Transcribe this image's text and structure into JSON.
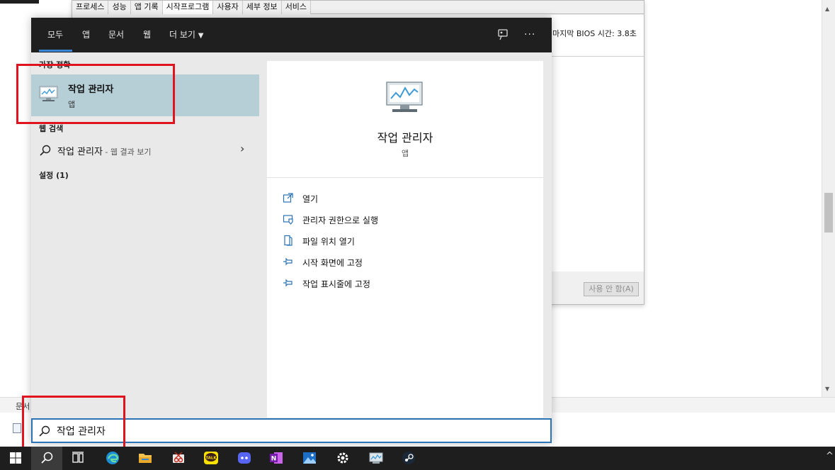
{
  "background_doc": {
    "status_text": "문서"
  },
  "msconfig": {
    "tabs": [
      "프로세스",
      "성능",
      "앱 기록",
      "시작프로그램",
      "사용자",
      "세부 정보",
      "서비스"
    ],
    "active_tab_index": 3,
    "bios_label": "마지막 BIOS 시간:",
    "bios_value": "3.8초",
    "disable_button": "사용 안 함(A)"
  },
  "search_panel": {
    "nav": {
      "all": "모두",
      "apps": "앱",
      "documents": "문서",
      "web": "웹",
      "more": "더 보기"
    },
    "left": {
      "best_match_heading": "가장 정확",
      "best_match_title": "작업 관리자",
      "best_match_type": "앱",
      "web_heading": "웹 검색",
      "web_result_text": "작업 관리자",
      "web_result_suffix": " - 웹 결과 보기",
      "settings_heading": "설정 (1)"
    },
    "right": {
      "title": "작업 관리자",
      "subtitle": "앱",
      "actions": [
        {
          "icon": "open-icon",
          "label": "열기"
        },
        {
          "icon": "shield-icon",
          "label": "관리자 권한으로 실행"
        },
        {
          "icon": "file-location-icon",
          "label": "파일 위치 열기"
        },
        {
          "icon": "pin-icon",
          "label": "시작 화면에 고정"
        },
        {
          "icon": "pin-icon",
          "label": "작업 표시줄에 고정"
        }
      ]
    },
    "search_box": {
      "value": "작업 관리자"
    }
  },
  "taskbar": {
    "items": [
      "windows-start-icon",
      "search-icon",
      "task-view-icon",
      "edge-icon",
      "file-explorer-icon",
      "snipping-tool-icon",
      "kakaotalk-icon",
      "discord-icon",
      "onenote-icon",
      "photos-icon",
      "settings-icon",
      "task-manager-icon",
      "steam-icon"
    ],
    "kakaotalk_label": "TALK",
    "onenote_label": "N"
  },
  "colors": {
    "accent": "#2b73b5",
    "highlight_red": "#e0141e",
    "selected_row": "#b6cfd7",
    "nav_bg": "#1f1f1f"
  }
}
